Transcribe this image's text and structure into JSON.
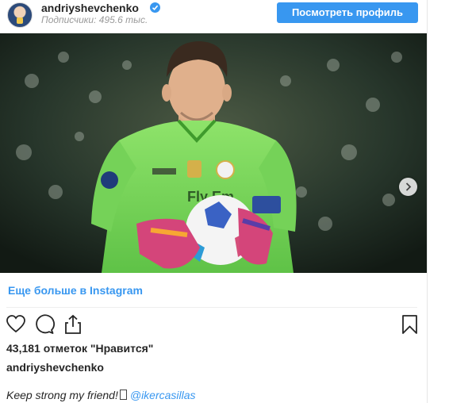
{
  "header": {
    "username": "andriyshevchenko",
    "followers": "Подписчики: 495.6 тыс.",
    "view_profile": "Посмотреть профиль"
  },
  "media": {
    "jersey_text": "Fly Em",
    "carousel_next_icon": "chevron-right-icon"
  },
  "more_link": "Еще больше в Instagram",
  "actions": [
    "heart-icon",
    "comment-icon",
    "share-icon",
    "bookmark-icon"
  ],
  "likes": "43,181 отметок \"Нравится\"",
  "owner": "andriyshevchenko",
  "caption": {
    "text": "Keep strong my friend!",
    "mention": "@ikercasillas"
  },
  "colors": {
    "accent": "#3897f0",
    "text": "#262626",
    "muted": "#9a9a9a"
  }
}
